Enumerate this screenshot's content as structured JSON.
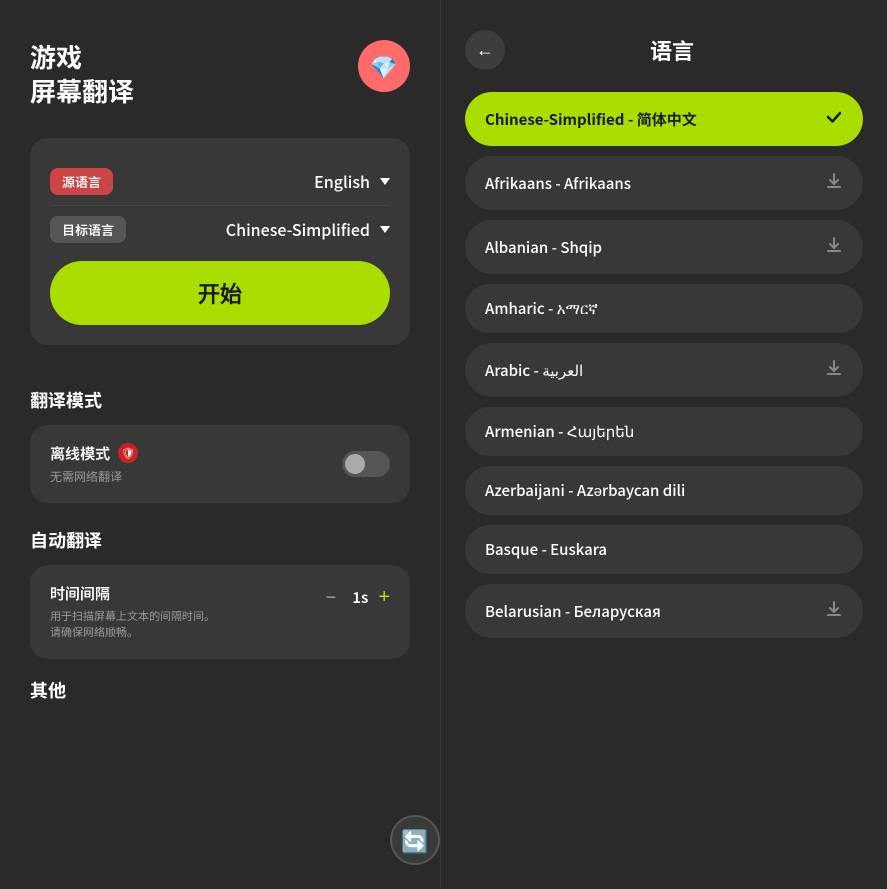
{
  "app": {
    "title_line1": "游戏",
    "title_line2": "屏幕翻译",
    "gem_icon": "💎"
  },
  "settings": {
    "source_label": "源语言",
    "source_value": "English",
    "target_label": "目标语言",
    "target_value": "Chinese-Simplified",
    "start_button": "开始"
  },
  "translation_mode": {
    "section_title": "翻译模式",
    "offline_label": "离线模式",
    "offline_badge": "🛡",
    "offline_sub": "无需网络翻译"
  },
  "auto_translate": {
    "section_title": "自动翻译",
    "interval_title": "时间间隔",
    "interval_sub1": "用于扫描屏幕上文本的间隔时间。",
    "interval_sub2": "请确保网络顺畅。",
    "interval_value": "1s",
    "minus_label": "−",
    "plus_label": "+"
  },
  "other": {
    "section_title": "其他"
  },
  "right_panel": {
    "back_icon": "←",
    "title": "语言",
    "languages": [
      {
        "name": "Chinese-Simplified - 简体中文",
        "selected": true,
        "action": "✔"
      },
      {
        "name": "Afrikaans - Afrikaans",
        "selected": false,
        "action": "⬇"
      },
      {
        "name": "Albanian - Shqip",
        "selected": false,
        "action": "⬇"
      },
      {
        "name": "Amharic - አማርኛ",
        "selected": false,
        "action": ""
      },
      {
        "name": "Arabic - العربية",
        "selected": false,
        "action": "⬇"
      },
      {
        "name": "Armenian - Հայերեն",
        "selected": false,
        "action": ""
      },
      {
        "name": "Azerbaijani - Azərbaycan dili",
        "selected": false,
        "action": ""
      },
      {
        "name": "Basque - Euskara",
        "selected": false,
        "action": ""
      },
      {
        "name": "Belarusian - Беларуская",
        "selected": false,
        "action": "⬇"
      }
    ],
    "floating_icon": "🔄"
  }
}
